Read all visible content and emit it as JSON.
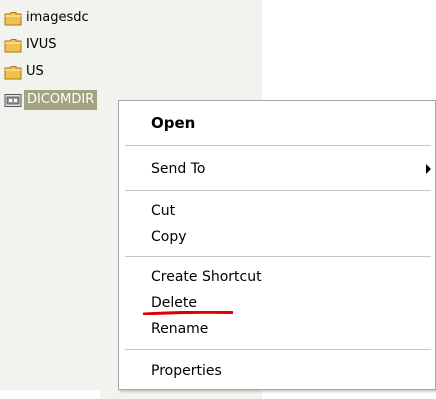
{
  "explorer": {
    "items": [
      {
        "label": "imagesdc",
        "icon": "folder-icon"
      },
      {
        "label": "IVUS",
        "icon": "folder-icon"
      },
      {
        "label": "US",
        "icon": "folder-icon"
      },
      {
        "label": "DICOMDIR",
        "icon": "dicomdir-file-icon",
        "selected": true
      }
    ]
  },
  "context_menu": {
    "open": "Open",
    "send_to": "Send To",
    "cut": "Cut",
    "copy": "Copy",
    "create_shortcut": "Create Shortcut",
    "delete": "Delete",
    "rename": "Rename",
    "properties": "Properties"
  },
  "colors": {
    "selection": "#a3a37f",
    "folder": "#f0c24b",
    "annotation_underline": "#e00000"
  }
}
